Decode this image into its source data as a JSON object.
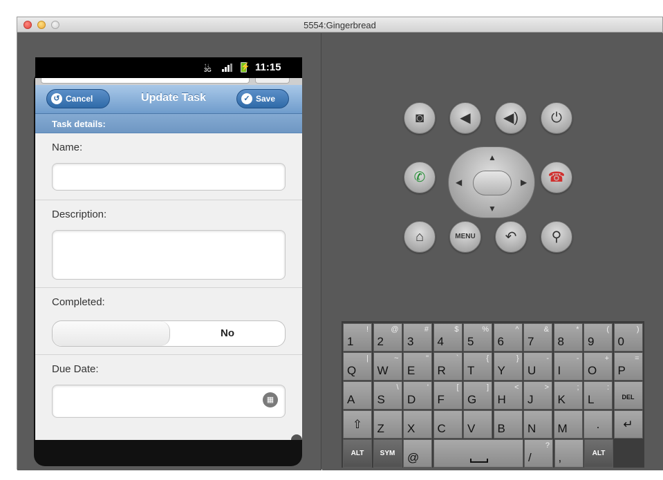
{
  "window": {
    "title": "5554:Gingerbread"
  },
  "phone": {
    "status": {
      "time": "11:15",
      "network": "3G"
    },
    "header": {
      "cancel_label": "Cancel",
      "title": "Update Task",
      "save_label": "Save"
    },
    "section_title": "Task details:",
    "fields": {
      "name_label": "Name:",
      "name_value": "",
      "description_label": "Description:",
      "description_value": "",
      "completed_label": "Completed:",
      "completed_value": "No",
      "due_date_label": "Due Date:",
      "due_date_value": ""
    }
  },
  "controls": {
    "row1": [
      "camera-icon",
      "volume-down-icon",
      "volume-up-icon",
      "power-icon"
    ],
    "row2": [
      "call-icon",
      "dpad",
      "end-call-icon"
    ],
    "row3_menu_label": "MENU"
  },
  "keyboard": {
    "row1": [
      [
        "1",
        "!"
      ],
      [
        "2",
        "@"
      ],
      [
        "3",
        "#"
      ],
      [
        "4",
        "$"
      ],
      [
        "5",
        "%"
      ],
      [
        "6",
        "^"
      ],
      [
        "7",
        "&"
      ],
      [
        "8",
        "*"
      ],
      [
        "9",
        "("
      ],
      [
        "0",
        ")"
      ]
    ],
    "row2": [
      [
        "Q",
        "|"
      ],
      [
        "W",
        "~"
      ],
      [
        "E",
        "\""
      ],
      [
        "R",
        "`"
      ],
      [
        "T",
        "{"
      ],
      [
        "Y",
        "}"
      ],
      [
        "U",
        "-"
      ],
      [
        "I",
        "-"
      ],
      [
        "O",
        "+"
      ],
      [
        "P",
        "="
      ]
    ],
    "row3": [
      [
        "A",
        ""
      ],
      [
        "S",
        "\\"
      ],
      [
        "D",
        "'"
      ],
      [
        "F",
        "["
      ],
      [
        "G",
        "]"
      ],
      [
        "H",
        "<"
      ],
      [
        "J",
        ">"
      ],
      [
        "K",
        ";"
      ],
      [
        "L",
        ":"
      ],
      [
        "DEL",
        ""
      ]
    ],
    "row4": [
      [
        "⇧",
        ""
      ],
      [
        "Z",
        ""
      ],
      [
        "X",
        ""
      ],
      [
        "C",
        ""
      ],
      [
        "V",
        ""
      ],
      [
        "B",
        ""
      ],
      [
        "N",
        ""
      ],
      [
        "M",
        ""
      ],
      [
        ".",
        ""
      ],
      [
        "↵",
        ""
      ]
    ],
    "row5": [
      [
        "ALT",
        ""
      ],
      [
        "SYM",
        ""
      ],
      [
        "@",
        ""
      ],
      [
        "",
        ""
      ],
      [
        "/",
        "?"
      ],
      [
        ",",
        ""
      ],
      [
        "ALT",
        ""
      ]
    ]
  },
  "colors": {
    "accent": "#6f9ccc",
    "end_call": "#d0302e",
    "call": "#1f8a2f"
  }
}
